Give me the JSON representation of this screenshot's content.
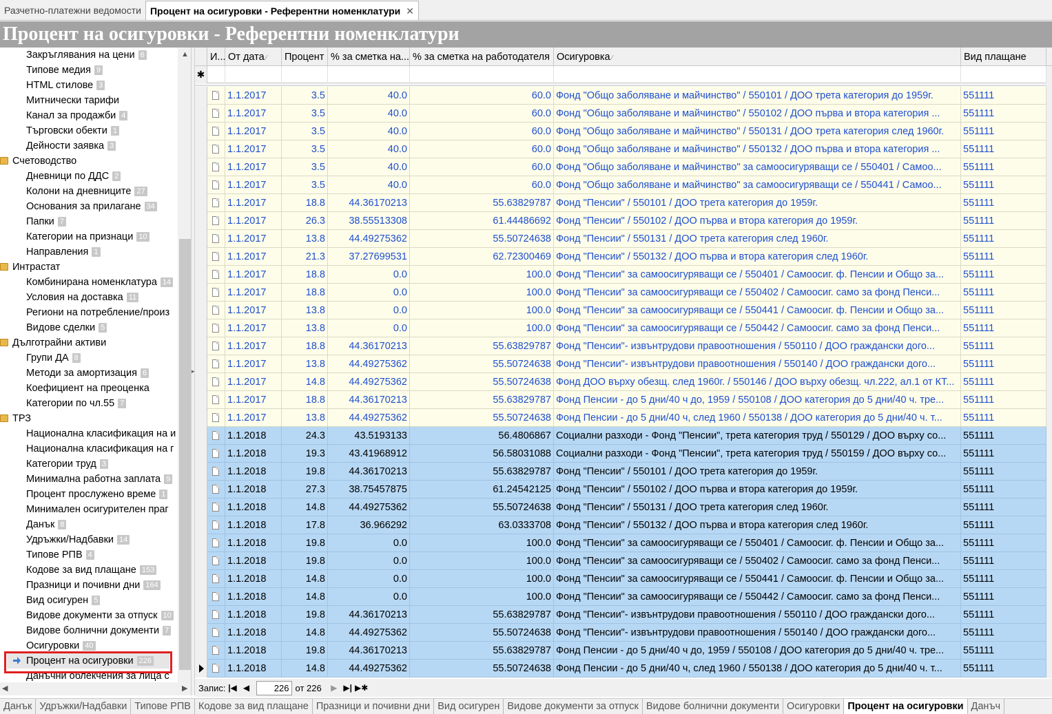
{
  "tabs": [
    {
      "label": "Разчетно-платежни ведомости",
      "active": false
    },
    {
      "label": "Процент на осигуровки - Референтни номенклатури",
      "active": true
    }
  ],
  "page_title": "Процент на осигуровки - Референтни номенклатури",
  "sidebar": {
    "items": [
      {
        "label": "Закръглявания на цени",
        "count": "6",
        "type": "child"
      },
      {
        "label": "Типове медия",
        "count": "9",
        "type": "child"
      },
      {
        "label": "HTML стилове",
        "count": "3",
        "type": "child"
      },
      {
        "label": "Митнически тарифи",
        "count": "",
        "type": "child"
      },
      {
        "label": "Канал за продажби",
        "count": "4",
        "type": "child"
      },
      {
        "label": "Търговски обекти",
        "count": "1",
        "type": "child"
      },
      {
        "label": "Дейности заявка",
        "count": "3",
        "type": "child"
      },
      {
        "label": "Счетоводство",
        "count": "",
        "type": "group"
      },
      {
        "label": "Дневници по ДДС",
        "count": "2",
        "type": "child"
      },
      {
        "label": "Колони на дневниците",
        "count": "27",
        "type": "child"
      },
      {
        "label": "Основания за прилагане",
        "count": "34",
        "type": "child"
      },
      {
        "label": "Папки",
        "count": "7",
        "type": "child"
      },
      {
        "label": "Категории на признаци",
        "count": "10",
        "type": "child"
      },
      {
        "label": "Направления",
        "count": "1",
        "type": "child"
      },
      {
        "label": "Интрастат",
        "count": "",
        "type": "group"
      },
      {
        "label": "Комбинирана номенклатура",
        "count": "14",
        "type": "child"
      },
      {
        "label": "Условия на доставка",
        "count": "11",
        "type": "child"
      },
      {
        "label": "Региони на потребление/произ",
        "count": "",
        "type": "child"
      },
      {
        "label": "Видове сделки",
        "count": "5",
        "type": "child"
      },
      {
        "label": "Дълготрайни активи",
        "count": "",
        "type": "group"
      },
      {
        "label": "Групи ДА",
        "count": "8",
        "type": "child"
      },
      {
        "label": "Методи за амортизация",
        "count": "6",
        "type": "child"
      },
      {
        "label": "Коефициент на преоценка",
        "count": "",
        "type": "child"
      },
      {
        "label": "Категории по чл.55",
        "count": "7",
        "type": "child"
      },
      {
        "label": "ТРЗ",
        "count": "",
        "type": "group"
      },
      {
        "label": "Национална класификация на и",
        "count": "",
        "type": "child"
      },
      {
        "label": "Национална класификация на г",
        "count": "",
        "type": "child"
      },
      {
        "label": "Категории труд",
        "count": "3",
        "type": "child"
      },
      {
        "label": "Минимална работна заплата",
        "count": "9",
        "type": "child"
      },
      {
        "label": "Процент прослужено време",
        "count": "1",
        "type": "child"
      },
      {
        "label": "Минимален осигурителен праг",
        "count": "",
        "type": "child"
      },
      {
        "label": "Данък",
        "count": "8",
        "type": "child"
      },
      {
        "label": "Удръжки/Надбавки",
        "count": "14",
        "type": "child"
      },
      {
        "label": "Типове РПВ",
        "count": "4",
        "type": "child"
      },
      {
        "label": "Кодове за вид плащане",
        "count": "153",
        "type": "child"
      },
      {
        "label": "Празници и почивни дни",
        "count": "164",
        "type": "child"
      },
      {
        "label": "Вид осигурен",
        "count": "5",
        "type": "child"
      },
      {
        "label": "Видове документи за отпуск",
        "count": "10",
        "type": "child"
      },
      {
        "label": "Видове болнични документи",
        "count": "7",
        "type": "child"
      },
      {
        "label": "Осигуровки",
        "count": "40",
        "type": "child"
      },
      {
        "label": "Процент на осигуровки",
        "count": "226",
        "type": "selected"
      },
      {
        "label": "Данъчни облекчения за лица с",
        "count": "",
        "type": "child"
      }
    ]
  },
  "grid": {
    "columns": [
      {
        "label": "И...",
        "sort": false
      },
      {
        "label": "От дата",
        "sort": true
      },
      {
        "label": "Процент",
        "sort": false
      },
      {
        "label": "% за сметка на...",
        "sort": false
      },
      {
        "label": "% за сметка на работодателя",
        "sort": false
      },
      {
        "label": "Осигуровка",
        "sort": true
      },
      {
        "label": "Вид плащане",
        "sort": false
      }
    ],
    "new_row_marker": "✱",
    "rows": [
      {
        "date": "1.1.2017",
        "pct": "3.5",
        "emp": "40.0",
        "er": "60.0",
        "ins": "Фонд \"Общо заболяване и майчинство\" / 550101 / ДОО трета категория до 1959г.",
        "pay": "551111",
        "year": "y17"
      },
      {
        "date": "1.1.2017",
        "pct": "3.5",
        "emp": "40.0",
        "er": "60.0",
        "ins": "Фонд \"Общо заболяване и майчинство\" / 550102 / ДОО първа и втора категория ...",
        "pay": "551111",
        "year": "y17"
      },
      {
        "date": "1.1.2017",
        "pct": "3.5",
        "emp": "40.0",
        "er": "60.0",
        "ins": "Фонд \"Общо заболяване и майчинство\" / 550131 / ДОО трета категория след 1960г.",
        "pay": "551111",
        "year": "y17"
      },
      {
        "date": "1.1.2017",
        "pct": "3.5",
        "emp": "40.0",
        "er": "60.0",
        "ins": "Фонд \"Общо заболяване и майчинство\" / 550132 / ДОО първа и втора категория ...",
        "pay": "551111",
        "year": "y17"
      },
      {
        "date": "1.1.2017",
        "pct": "3.5",
        "emp": "40.0",
        "er": "60.0",
        "ins": "Фонд \"Общо заболяване и майчинство\" за самоосигуряващи се / 550401 / Самоо...",
        "pay": "551111",
        "year": "y17"
      },
      {
        "date": "1.1.2017",
        "pct": "3.5",
        "emp": "40.0",
        "er": "60.0",
        "ins": "Фонд \"Общо заболяване и майчинство\" за самоосигуряващи се / 550441 / Самоо...",
        "pay": "551111",
        "year": "y17"
      },
      {
        "date": "1.1.2017",
        "pct": "18.8",
        "emp": "44.36170213",
        "er": "55.63829787",
        "ins": "Фонд \"Пенсии\" / 550101 / ДОО трета категория до 1959г.",
        "pay": "551111",
        "year": "y17"
      },
      {
        "date": "1.1.2017",
        "pct": "26.3",
        "emp": "38.55513308",
        "er": "61.44486692",
        "ins": "Фонд \"Пенсии\" / 550102 / ДОО първа и втора категория до 1959г.",
        "pay": "551111",
        "year": "y17"
      },
      {
        "date": "1.1.2017",
        "pct": "13.8",
        "emp": "44.49275362",
        "er": "55.50724638",
        "ins": "Фонд \"Пенсии\" / 550131 / ДОО трета категория след 1960г.",
        "pay": "551111",
        "year": "y17"
      },
      {
        "date": "1.1.2017",
        "pct": "21.3",
        "emp": "37.27699531",
        "er": "62.72300469",
        "ins": "Фонд \"Пенсии\" / 550132 / ДОО първа и втора категория след 1960г.",
        "pay": "551111",
        "year": "y17"
      },
      {
        "date": "1.1.2017",
        "pct": "18.8",
        "emp": "0.0",
        "er": "100.0",
        "ins": "Фонд \"Пенсии\" за самоосигуряващи се / 550401 / Самоосиг. ф. Пенсии и Общо за...",
        "pay": "551111",
        "year": "y17"
      },
      {
        "date": "1.1.2017",
        "pct": "18.8",
        "emp": "0.0",
        "er": "100.0",
        "ins": "Фонд \"Пенсии\" за самоосигуряващи се / 550402 / Самоосиг. само за фонд Пенси...",
        "pay": "551111",
        "year": "y17"
      },
      {
        "date": "1.1.2017",
        "pct": "13.8",
        "emp": "0.0",
        "er": "100.0",
        "ins": "Фонд \"Пенсии\" за самоосигуряващи се / 550441 / Самоосиг. ф. Пенсии и Общо за...",
        "pay": "551111",
        "year": "y17"
      },
      {
        "date": "1.1.2017",
        "pct": "13.8",
        "emp": "0.0",
        "er": "100.0",
        "ins": "Фонд \"Пенсии\" за самоосигуряващи се / 550442 / Самоосиг. само за фонд Пенси...",
        "pay": "551111",
        "year": "y17"
      },
      {
        "date": "1.1.2017",
        "pct": "18.8",
        "emp": "44.36170213",
        "er": "55.63829787",
        "ins": "Фонд \"Пенсии\"- извънтрудови правоотношения / 550110 / ДОО граждански дого...",
        "pay": "551111",
        "year": "y17"
      },
      {
        "date": "1.1.2017",
        "pct": "13.8",
        "emp": "44.49275362",
        "er": "55.50724638",
        "ins": "Фонд \"Пенсии\"- извънтрудови правоотношения / 550140 / ДОО граждански дого...",
        "pay": "551111",
        "year": "y17"
      },
      {
        "date": "1.1.2017",
        "pct": "14.8",
        "emp": "44.49275362",
        "er": "55.50724638",
        "ins": "Фонд ДОО върху обезщ. след 1960г. / 550146 / ДОО върху обезщ. чл.222, ал.1 от КТ...",
        "pay": "551111",
        "year": "y17"
      },
      {
        "date": "1.1.2017",
        "pct": "18.8",
        "emp": "44.36170213",
        "er": "55.63829787",
        "ins": "Фонд Пенсии - до 5 дни/40 ч до, 1959 / 550108 / ДОО категория до 5 дни/40 ч. тре...",
        "pay": "551111",
        "year": "y17"
      },
      {
        "date": "1.1.2017",
        "pct": "13.8",
        "emp": "44.49275362",
        "er": "55.50724638",
        "ins": "Фонд Пенсии - до 5 дни/40 ч, след 1960 / 550138 / ДОО категория до 5 дни/40 ч. т...",
        "pay": "551111",
        "year": "y17"
      },
      {
        "date": "1.1.2018",
        "pct": "24.3",
        "emp": "43.5193133",
        "er": "56.4806867",
        "ins": "Социални разходи - Фонд \"Пенсии\", трета категория труд / 550129 / ДОО върху со...",
        "pay": "551111",
        "year": "y18"
      },
      {
        "date": "1.1.2018",
        "pct": "19.3",
        "emp": "43.41968912",
        "er": "56.58031088",
        "ins": "Социални разходи - Фонд \"Пенсии\", трета категория труд / 550159 / ДОО върху со...",
        "pay": "551111",
        "year": "y18"
      },
      {
        "date": "1.1.2018",
        "pct": "19.8",
        "emp": "44.36170213",
        "er": "55.63829787",
        "ins": "Фонд \"Пенсии\" / 550101 / ДОО трета категория до 1959г.",
        "pay": "551111",
        "year": "y18"
      },
      {
        "date": "1.1.2018",
        "pct": "27.3",
        "emp": "38.75457875",
        "er": "61.24542125",
        "ins": "Фонд \"Пенсии\" / 550102 / ДОО първа и втора категория до 1959г.",
        "pay": "551111",
        "year": "y18"
      },
      {
        "date": "1.1.2018",
        "pct": "14.8",
        "emp": "44.49275362",
        "er": "55.50724638",
        "ins": "Фонд \"Пенсии\" / 550131 / ДОО трета категория след 1960г.",
        "pay": "551111",
        "year": "y18"
      },
      {
        "date": "1.1.2018",
        "pct": "17.8",
        "emp": "36.966292",
        "er": "63.0333708",
        "ins": "Фонд \"Пенсии\" / 550132 / ДОО първа и втора категория след 1960г.",
        "pay": "551111",
        "year": "y18"
      },
      {
        "date": "1.1.2018",
        "pct": "19.8",
        "emp": "0.0",
        "er": "100.0",
        "ins": "Фонд \"Пенсии\" за самоосигуряващи се / 550401 / Самоосиг. ф. Пенсии и Общо за...",
        "pay": "551111",
        "year": "y18"
      },
      {
        "date": "1.1.2018",
        "pct": "19.8",
        "emp": "0.0",
        "er": "100.0",
        "ins": "Фонд \"Пенсии\" за самоосигуряващи се / 550402 / Самоосиг. само за фонд Пенси...",
        "pay": "551111",
        "year": "y18"
      },
      {
        "date": "1.1.2018",
        "pct": "14.8",
        "emp": "0.0",
        "er": "100.0",
        "ins": "Фонд \"Пенсии\" за самоосигуряващи се / 550441 / Самоосиг. ф. Пенсии и Общо за...",
        "pay": "551111",
        "year": "y18"
      },
      {
        "date": "1.1.2018",
        "pct": "14.8",
        "emp": "0.0",
        "er": "100.0",
        "ins": "Фонд \"Пенсии\" за самоосигуряващи се / 550442 / Самоосиг. само за фонд Пенси...",
        "pay": "551111",
        "year": "y18"
      },
      {
        "date": "1.1.2018",
        "pct": "19.8",
        "emp": "44.36170213",
        "er": "55.63829787",
        "ins": "Фонд \"Пенсии\"- извънтрудови правоотношения / 550110 / ДОО граждански дого...",
        "pay": "551111",
        "year": "y18"
      },
      {
        "date": "1.1.2018",
        "pct": "14.8",
        "emp": "44.49275362",
        "er": "55.50724638",
        "ins": "Фонд \"Пенсии\"- извънтрудови правоотношения / 550140 / ДОО граждански дого...",
        "pay": "551111",
        "year": "y18"
      },
      {
        "date": "1.1.2018",
        "pct": "19.8",
        "emp": "44.36170213",
        "er": "55.63829787",
        "ins": "Фонд Пенсии - до 5 дни/40 ч до, 1959 / 550108 / ДОО категория до 5 дни/40 ч. тре...",
        "pay": "551111",
        "year": "y18"
      },
      {
        "date": "1.1.2018",
        "pct": "14.8",
        "emp": "44.49275362",
        "er": "55.50724638",
        "ins": "Фонд Пенсии - до 5 дни/40 ч, след 1960 / 550138 / ДОО категория до 5 дни/40 ч. т...",
        "pay": "551111",
        "year": "y18",
        "current": true
      }
    ]
  },
  "navigator": {
    "label": "Запис:",
    "current": "226",
    "of_label": "от 226"
  },
  "bottom_tabs": [
    {
      "label": "Данък",
      "active": false
    },
    {
      "label": "Удръжки/Надбавки",
      "active": false
    },
    {
      "label": "Типове РПВ",
      "active": false
    },
    {
      "label": "Кодове за вид плащане",
      "active": false
    },
    {
      "label": "Празници и почивни дни",
      "active": false
    },
    {
      "label": "Вид осигурен",
      "active": false
    },
    {
      "label": "Видове документи за отпуск",
      "active": false
    },
    {
      "label": "Видове болнични документи",
      "active": false
    },
    {
      "label": "Осигуровки",
      "active": false
    },
    {
      "label": "Процент на осигуровки",
      "active": true
    },
    {
      "label": "Данъч",
      "active": false
    }
  ],
  "colors": {
    "row_2017": "#fefde9",
    "row_2018": "#b7d8f4",
    "link_blue": "#1e4fd0",
    "highlight": "#e0201f"
  }
}
